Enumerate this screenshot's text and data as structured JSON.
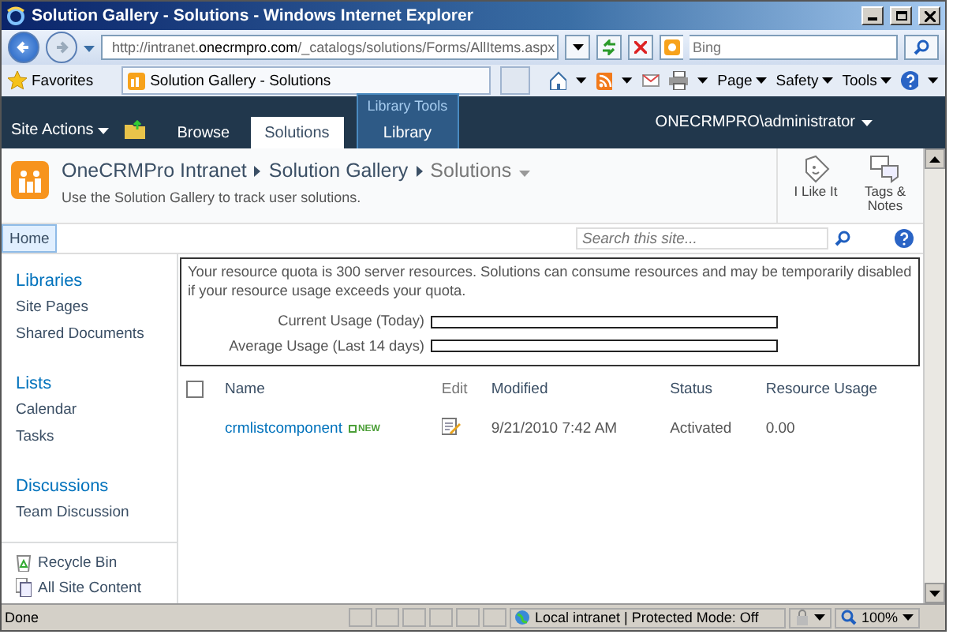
{
  "window": {
    "title": "Solution Gallery - Solutions - Windows Internet Explorer"
  },
  "address_bar": {
    "url": "http://intranet.**onecrmpro.com**/_catalogs/solutions/Forms/AllItems.aspx"
  },
  "search_box": {
    "placeholder": "Bing"
  },
  "favorites": {
    "label": "Favorites",
    "tab": "Solution Gallery - Solutions"
  },
  "command_bar": [
    "Page",
    "Safety",
    "Tools"
  ],
  "ribbon": {
    "site_actions": "Site Actions",
    "tabs": [
      {
        "label": "Browse",
        "selected": false
      },
      {
        "label": "Solutions",
        "selected": true
      },
      {
        "label": "Library",
        "group": "Library Tools",
        "selected": false
      }
    ],
    "user": "ONECRMPRO\\administrator"
  },
  "title_area": {
    "breadcrumb": [
      "OneCRMPro Intranet",
      "Solution Gallery",
      "Solutions"
    ],
    "description": "Use the Solution Gallery to track user solutions.",
    "actions": [
      "I Like It",
      "Tags & Notes"
    ]
  },
  "top_nav": {
    "items": [
      {
        "label": "Home",
        "selected": true
      }
    ],
    "search_placeholder": "Search this site..."
  },
  "quick_launch": {
    "sections": [
      {
        "heading": "Libraries",
        "items": [
          "Site Pages",
          "Shared Documents"
        ]
      },
      {
        "heading": "Lists",
        "items": [
          "Calendar",
          "Tasks"
        ]
      },
      {
        "heading": "Discussions",
        "items": [
          "Team Discussion"
        ]
      }
    ],
    "footer": [
      "Recycle Bin",
      "All Site Content"
    ]
  },
  "quota": {
    "message": "Your resource quota is 300 server resources. Solutions can consume resources and may be temporarily disabled if your resource usage exceeds your quota.",
    "usage": [
      {
        "label": "Current Usage (Today)",
        "level": 0
      },
      {
        "label": "Average Usage (Last 14 days)",
        "level": 0
      }
    ]
  },
  "table": {
    "select_all_checked": false,
    "columns": [
      "Name",
      "Edit",
      "Modified",
      "Status",
      "Resource Usage"
    ],
    "rows": [
      {
        "name": "crmlistcomponent",
        "badge": "NEW",
        "modified": "9/21/2010 7:42 AM",
        "status": "Activated",
        "resource_usage": "0.00"
      }
    ]
  },
  "status_bar": {
    "text": "Done",
    "zone": "Local intranet | Protected Mode: Off",
    "zoom": "100%"
  }
}
